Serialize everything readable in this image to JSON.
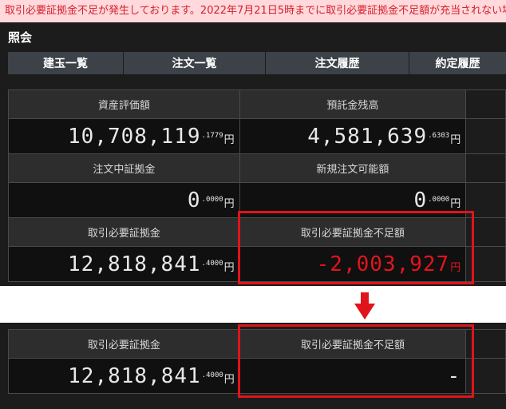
{
  "alert": {
    "text": "取引必要証拠金不足が発生しております。2022年7月21日5時までに取引必要証拠金不足額が充当されない場合"
  },
  "panel": {
    "title": "照会"
  },
  "tabs": [
    {
      "label": "建玉一覧"
    },
    {
      "label": "注文一覧"
    },
    {
      "label": "注文履歴"
    },
    {
      "label": "約定履歴"
    }
  ],
  "summary": {
    "asset_value": {
      "label": "資産評価額",
      "integer": "10,708,119",
      "decimal": ".1779",
      "unit": "円"
    },
    "deposit_balance": {
      "label": "預託金残高",
      "integer": "4,581,639",
      "decimal": ".6303",
      "unit": "円"
    },
    "order_margin": {
      "label": "注文中証拠金",
      "integer": "0",
      "decimal": ".0000",
      "unit": "円"
    },
    "new_order_capacity": {
      "label": "新規注文可能額",
      "integer": "0",
      "decimal": ".0000",
      "unit": "円"
    },
    "required_margin": {
      "label": "取引必要証拠金",
      "integer": "12,818,841",
      "decimal": ".4000",
      "unit": "円"
    },
    "margin_shortfall": {
      "label": "取引必要証拠金不足額",
      "integer": "-2,003,927",
      "unit": "円"
    }
  },
  "after": {
    "required_margin": {
      "label": "取引必要証拠金",
      "integer": "12,818,841",
      "decimal": ".4000",
      "unit": "円"
    },
    "margin_shortfall": {
      "label": "取引必要証拠金不足額",
      "value": "-"
    }
  },
  "colors": {
    "alert_bg": "#ffd9dc",
    "alert_text": "#d4202a",
    "highlight": "#e0141b",
    "negative": "#e3141b"
  }
}
